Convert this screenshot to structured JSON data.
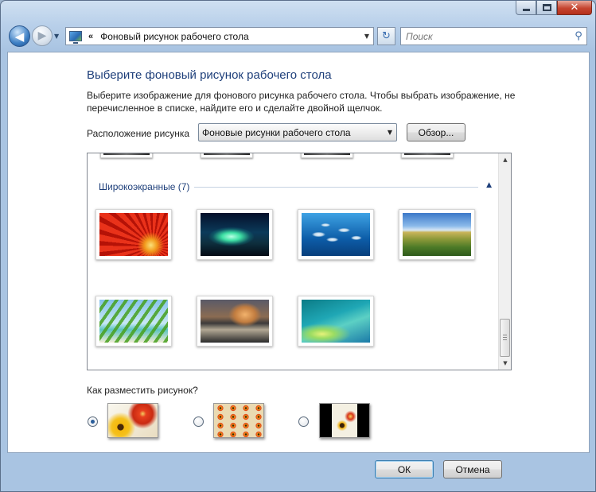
{
  "window": {
    "caption": {
      "close": "✕"
    }
  },
  "nav": {
    "back": "◀",
    "forward": "▶",
    "recent": "▼",
    "address_sep": "«",
    "address_text": "Фоновый рисунок рабочего стола",
    "address_drop": "▼",
    "refresh": "↻",
    "search_placeholder": "Поиск",
    "search_icon": "⚲"
  },
  "main": {
    "title": "Выберите фоновый рисунок рабочего стола",
    "description": "Выберите изображение для фонового рисунка рабочего стола. Чтобы выбрать изображение, не перечисленное в списке, найдите его и сделайте двойной щелчок.",
    "location_label": "Расположение рисунка",
    "location_value": "Фоновые рисунки рабочего стола",
    "location_drop": "▼",
    "browse": "Обзор...",
    "gallery": {
      "group_header": "Широкоэкранные (7)",
      "collapse": "▲",
      "images": [
        {
          "name": "gerbera",
          "icon": "img-gerbera"
        },
        {
          "name": "aurora",
          "icon": "img-aurora"
        },
        {
          "name": "fish",
          "icon": "img-fish"
        },
        {
          "name": "hills",
          "icon": "img-hills"
        },
        {
          "name": "palm",
          "icon": "img-palm"
        },
        {
          "name": "yosemite",
          "icon": "img-yosemite"
        },
        {
          "name": "aero",
          "icon": "img-aero"
        }
      ],
      "scroll_up": "▲",
      "scroll_down": "▼"
    },
    "position_label": "Как разместить рисунок?",
    "positions": [
      "fill",
      "tile",
      "center"
    ],
    "position_selected": "fill"
  },
  "buttons": {
    "ok": "ОК",
    "cancel": "Отмена"
  },
  "colors": {
    "title_blue": "#1e3f7a",
    "frame": "#a9c4e2",
    "close_red": "#c5442f"
  }
}
